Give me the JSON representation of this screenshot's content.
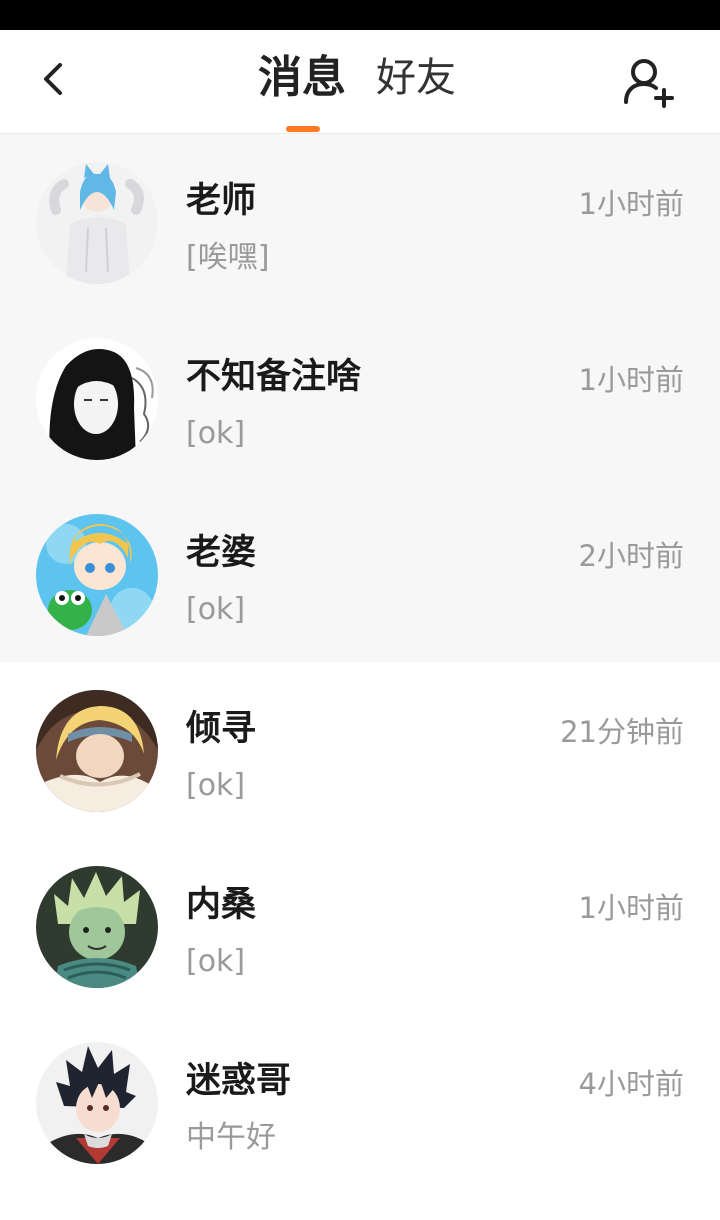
{
  "header": {
    "tabs": [
      {
        "label": "消息",
        "active": true
      },
      {
        "label": "好友",
        "active": false
      }
    ],
    "accent_color": "#ff7a22"
  },
  "conversations": [
    {
      "name": "老师",
      "preview": "[唉嘿]",
      "time": "1小时前",
      "avatar": "anime-avatar-blue-hair-catears",
      "shaded": true
    },
    {
      "name": "不知备注啥",
      "preview": "[ok]",
      "time": "1小时前",
      "avatar": "anime-avatar-monochrome-long-hair",
      "shaded": true
    },
    {
      "name": "老婆",
      "preview": "[ok]",
      "time": "2小时前",
      "avatar": "anime-avatar-blond-with-frog",
      "shaded": true
    },
    {
      "name": "倾寻",
      "preview": "[ok]",
      "time": "21分钟前",
      "avatar": "anime-avatar-blond-headband",
      "shaded": false
    },
    {
      "name": "内桑",
      "preview": "[ok]",
      "time": "1小时前",
      "avatar": "anime-avatar-green-spiky-hair",
      "shaded": false
    },
    {
      "name": "迷惑哥",
      "preview": "中午好",
      "time": "4小时前",
      "avatar": "anime-avatar-dark-spiky-hair",
      "shaded": false
    }
  ]
}
